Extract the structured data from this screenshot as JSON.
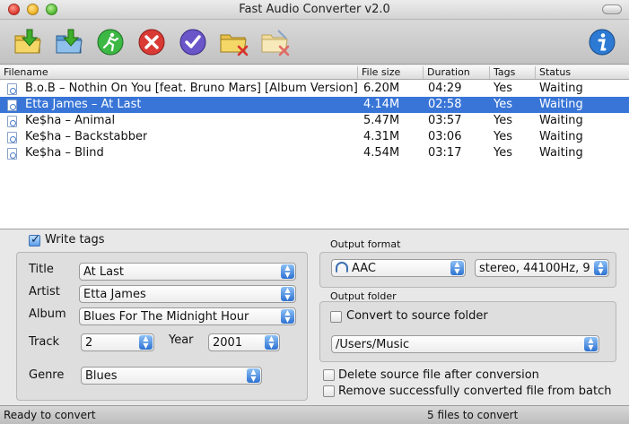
{
  "window": {
    "title": "Fast Audio Converter v2.0"
  },
  "toolbar": {
    "buttons": [
      {
        "name": "add-files-button",
        "icon": "add-files-icon"
      },
      {
        "name": "add-folder-button",
        "icon": "add-folder-icon"
      },
      {
        "name": "convert-button",
        "icon": "run-icon"
      },
      {
        "name": "stop-button",
        "icon": "stop-icon"
      },
      {
        "name": "check-button",
        "icon": "check-icon"
      },
      {
        "name": "remove-files-button",
        "icon": "remove-folder-icon"
      },
      {
        "name": "clear-list-button",
        "icon": "clear-list-icon"
      },
      {
        "name": "info-button",
        "icon": "info-icon"
      }
    ]
  },
  "table": {
    "columns": [
      "Filename",
      "File size",
      "Duration",
      "Tags",
      "Status"
    ],
    "rows": [
      {
        "filename": "B.o.B – Nothin On You [feat. Bruno Mars] [Album Version]",
        "size": "6.20M",
        "duration": "04:29",
        "tags": "Yes",
        "status": "Waiting"
      },
      {
        "filename": "Etta James – At Last",
        "size": "4.14M",
        "duration": "02:58",
        "tags": "Yes",
        "status": "Waiting"
      },
      {
        "filename": "Ke$ha – Animal",
        "size": "5.47M",
        "duration": "03:57",
        "tags": "Yes",
        "status": "Waiting"
      },
      {
        "filename": "Ke$ha – Backstabber",
        "size": "4.31M",
        "duration": "03:06",
        "tags": "Yes",
        "status": "Waiting"
      },
      {
        "filename": "Ke$ha – Blind",
        "size": "4.54M",
        "duration": "03:17",
        "tags": "Yes",
        "status": "Waiting"
      }
    ],
    "selected_row": 1
  },
  "tags": {
    "write_tags_label": "Write tags",
    "title_label": "Title",
    "title_value": "At Last",
    "artist_label": "Artist",
    "artist_value": "Etta James",
    "album_label": "Album",
    "album_value": "Blues For The Midnight Hour",
    "track_label": "Track",
    "track_value": "2",
    "year_label": "Year",
    "year_value": "2001",
    "genre_label": "Genre",
    "genre_value": "Blues"
  },
  "output": {
    "format_label": "Output format",
    "format_value": "AAC",
    "format_options_value": "stereo, 44100Hz, 9",
    "folder_label": "Output folder",
    "convert_to_source_label": "Convert to source folder",
    "folder_value": "/Users/Music",
    "delete_source_label": "Delete source file after conversion",
    "remove_converted_label": "Remove successfully converted file from batch"
  },
  "status": {
    "left": "Ready to convert",
    "right": "5 files to convert"
  },
  "colors": {
    "selection": "#3875d7",
    "accent": "#2e72d2"
  }
}
